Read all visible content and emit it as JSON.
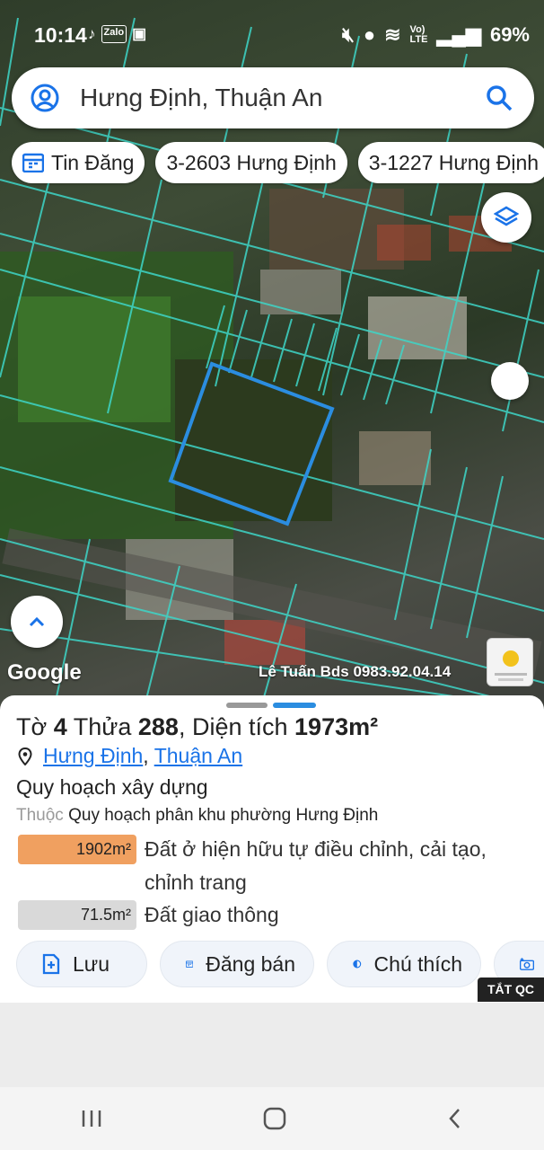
{
  "status_bar": {
    "time": "10:14",
    "left_icons": [
      "tiktok-icon",
      "zalo-icon",
      "gallery-icon"
    ],
    "right_icons": [
      "mute-icon",
      "location-icon",
      "wifi-icon",
      "volte-icon",
      "signal-icon"
    ],
    "battery": "69%"
  },
  "search": {
    "value": "Hưng Định, Thuận An"
  },
  "chips": [
    {
      "label": "Tin Đăng",
      "icon": "calendar-icon"
    },
    {
      "label": "3-2603 Hưng Định"
    },
    {
      "label": "3-1227 Hưng Định"
    }
  ],
  "map": {
    "attribution": "Google",
    "watermark": "Lê Tuấn Bds 0983.92.04.14",
    "highlight_color": "#2b8de0",
    "parcel_color": "#3ed6c8"
  },
  "parcel": {
    "title_prefix": "Tờ",
    "sheet_no": "4",
    "plot_label": "Thửa",
    "plot_no": "288",
    "area_label": ", Diện tích",
    "area": "1973m²",
    "ward": "Hưng Định",
    "sep": ",",
    "city": "Thuận An",
    "section": "Quy hoạch xây dựng",
    "belongs_label": "Thuộc",
    "belongs_value": "Quy hoạch phân khu phường Hưng Định",
    "zones": [
      {
        "area": "1902m²",
        "desc": "Đất ở hiện hữu tự điều chỉnh, cải tạo, chỉnh trang",
        "color": "#f0a060"
      },
      {
        "area": "71.5m²",
        "desc": "Đất giao thông",
        "color": "#d9d9d9"
      }
    ]
  },
  "actions": [
    {
      "label": "Lưu",
      "icon": "add-file-icon"
    },
    {
      "label": "Đăng bán",
      "icon": "calendar-icon"
    },
    {
      "label": "Chú thích",
      "icon": "contrast-icon"
    },
    {
      "label": "",
      "icon": "camera-icon"
    }
  ],
  "ad_close": "TẮT QC"
}
